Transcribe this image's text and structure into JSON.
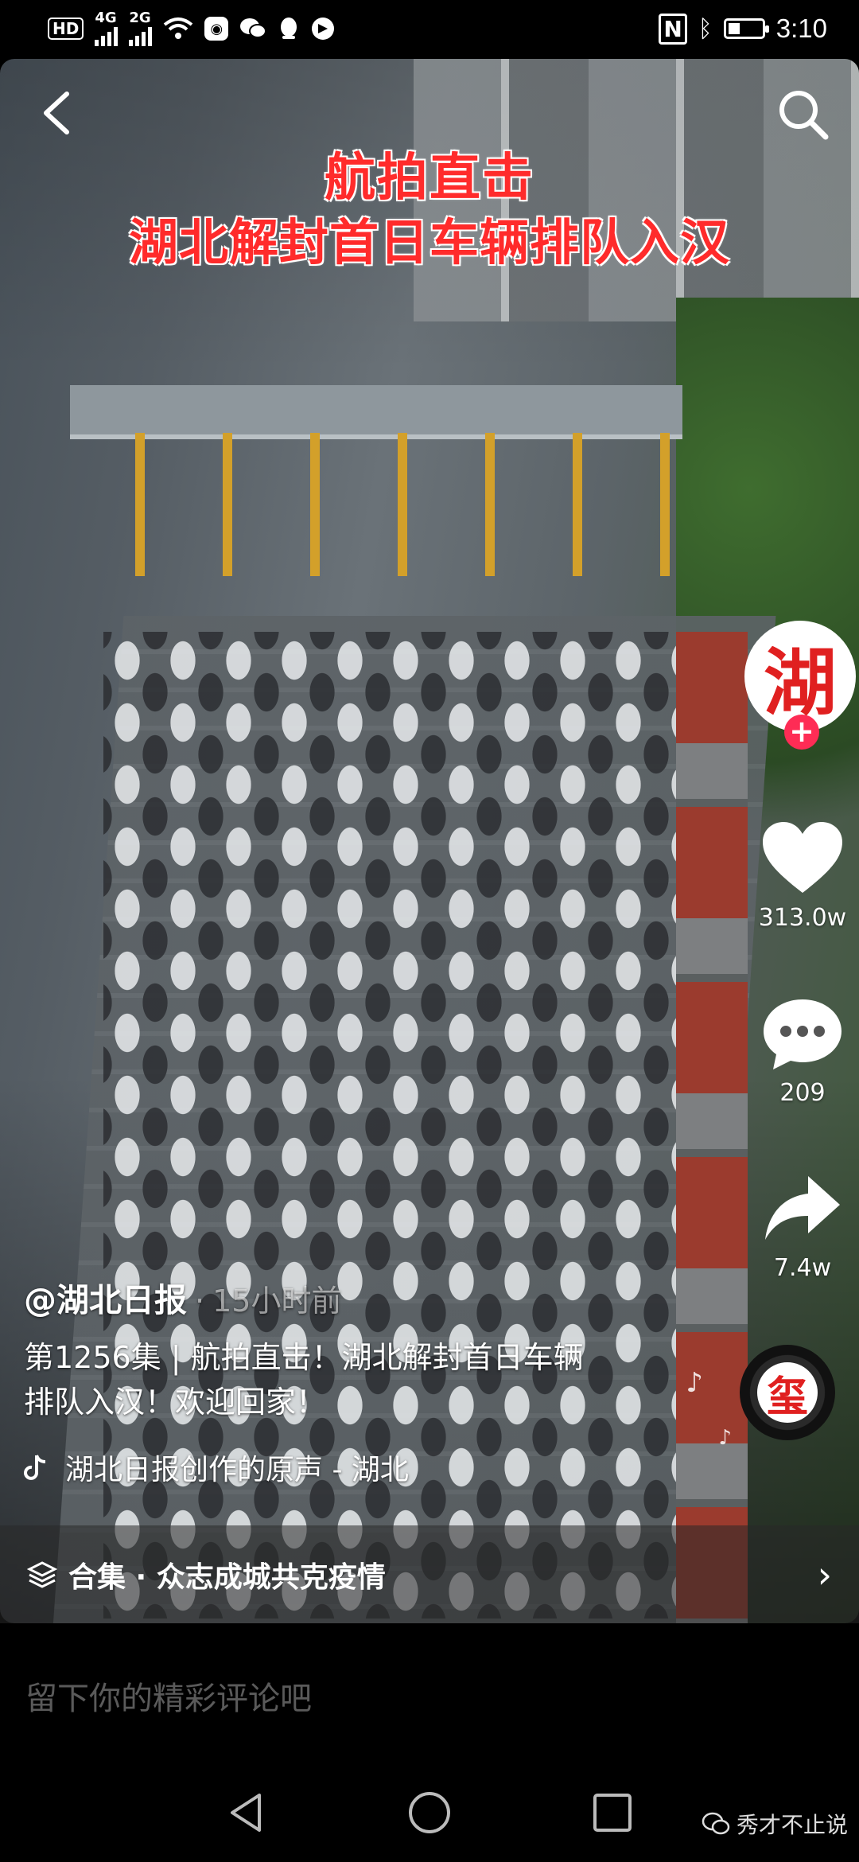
{
  "status_bar": {
    "network_badge": "HD",
    "sim1": "4G",
    "sim2": "2G",
    "time": "3:10",
    "battery_percent": 35,
    "left_icons": [
      "hd-icon",
      "signal-4g-icon",
      "signal-2g-icon",
      "wifi-icon",
      "app-notification-icon",
      "wechat-icon",
      "qq-icon",
      "shield-app-icon"
    ],
    "right_icons": [
      "nfc-icon",
      "bluetooth-icon",
      "battery-icon"
    ]
  },
  "video": {
    "overlay_title_line1": "航拍直击",
    "overlay_title_line2": "湖北解封首日车辆排队入汉"
  },
  "top_controls": {
    "back_icon": "chevron-left-icon",
    "search_icon": "search-icon"
  },
  "right_rail": {
    "avatar_char": "湖",
    "follow_icon": "plus-icon",
    "likes": "313.0w",
    "comments": "209",
    "shares": "7.4w",
    "disc_char": "玺"
  },
  "bottom_info": {
    "author": "@湖北日报",
    "separator": "·",
    "time_ago": "15小时前",
    "description": "第1256集 | 航拍直击！湖北解封首日车辆排队入汉！欢迎回家！",
    "music_text": "湖北日报创作的原声 - 湖北"
  },
  "collection": {
    "label": "合集 · 众志成城共克疫情"
  },
  "comment": {
    "placeholder": "留下你的精彩评论吧"
  },
  "watermark": {
    "text": "秀才不止说"
  },
  "colors": {
    "title_red": "#ff2b2b",
    "follow_pink": "#fe2c55",
    "background": "#000000"
  }
}
